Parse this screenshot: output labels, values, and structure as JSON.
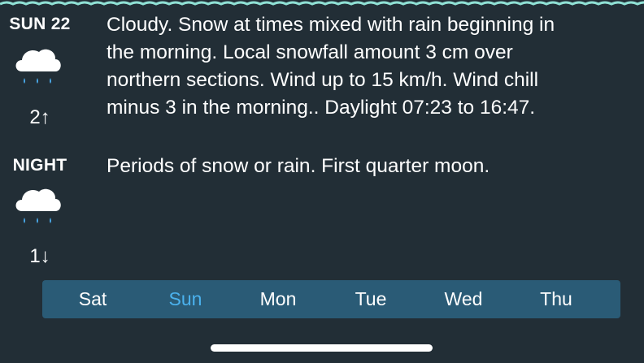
{
  "colors": {
    "background": "#222e36",
    "wave_border": "#8fe0d4",
    "day_selector_bg": "#2a5b76",
    "active_day": "#4bb2ee",
    "rain_drop": "#4aa8e8",
    "text": "#ffffff"
  },
  "forecast": {
    "day": {
      "label": "SUN 22",
      "icon": "cloud-rain-icon",
      "temp": "2↑",
      "description": "Cloudy. Snow at times mixed with rain beginning in\nthe morning. Local snowfall amount 3 cm over\nnorthern sections. Wind up to 15 km/h. Wind chill\nminus 3 in the morning.. Daylight 07:23 to 16:47."
    },
    "night": {
      "label": "NIGHT",
      "icon": "cloud-rain-icon",
      "temp": "1↓",
      "description": "Periods of snow or rain. First quarter moon."
    }
  },
  "day_selector": {
    "days": [
      "Sat",
      "Sun",
      "Mon",
      "Tue",
      "Wed",
      "Thu"
    ],
    "active": "Sun"
  }
}
